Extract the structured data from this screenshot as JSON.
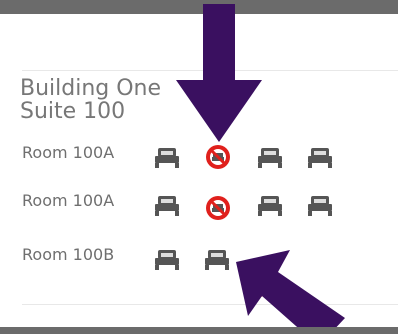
{
  "building": {
    "title_line1": "Building One",
    "title_line2": "Suite 100"
  },
  "rooms": [
    {
      "label": "Room 100A",
      "beds": [
        "available",
        "unavailable",
        "available",
        "available"
      ]
    },
    {
      "label": "Room 100A",
      "beds": [
        "available",
        "unavailable",
        "available",
        "available"
      ]
    },
    {
      "label": "Room 100B",
      "beds": [
        "available",
        "available"
      ]
    }
  ],
  "icons": {
    "bed": "bed-icon",
    "unavailable": "no-entry-icon",
    "annotation_arrow": "arrow-icon"
  },
  "colors": {
    "bed": "#555555",
    "unavailable": "#e0201c",
    "arrow": "#3a1060",
    "chrome": "#6b6b6b"
  }
}
